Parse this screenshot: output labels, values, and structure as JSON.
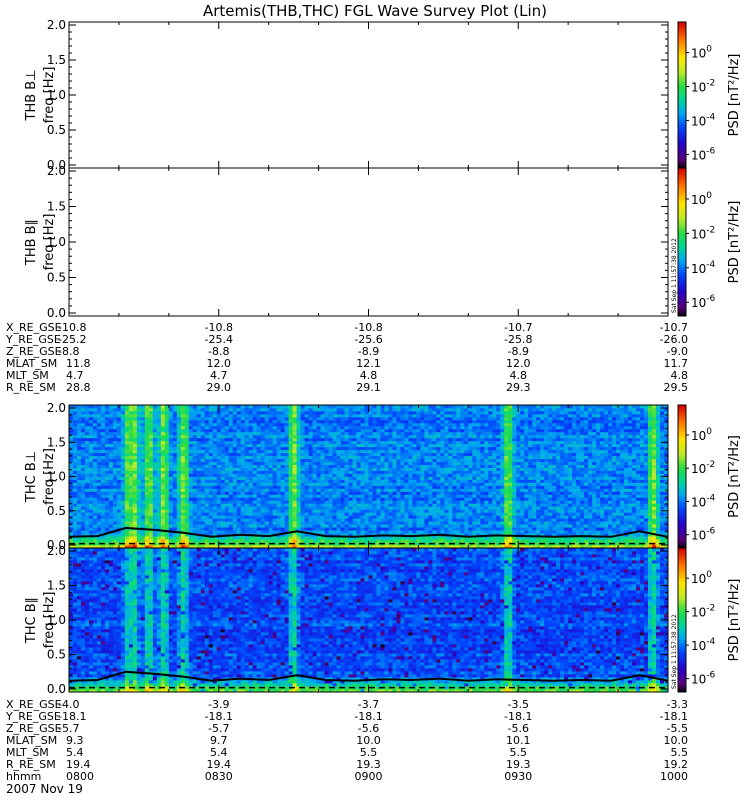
{
  "title": "Artemis(THB,THC) FGL Wave Survey Plot (Lin)",
  "stamp": "Sat Sep 1 11:57:38 2012",
  "date_label": "2007 Nov 19",
  "colorbar": {
    "label": "PSD [nT²/Hz]",
    "tick_labels": [
      "10^-6",
      "10^-4",
      "10^-2",
      "10^0"
    ],
    "log_range": [
      -6.8,
      1.8
    ]
  },
  "chart_data": [
    {
      "type": "heatmap",
      "panel": "THB B⊥",
      "ylabel_top": "THB B⊥",
      "ylabel_bottom": "freq [Hz]",
      "ylim": [
        0,
        2.0
      ],
      "yticks": [
        "0.0",
        "0.5",
        "1.0",
        "1.5",
        "2.0"
      ],
      "has_data": false
    },
    {
      "type": "heatmap",
      "panel": "THB B∥",
      "ylabel_top": "THB B∥",
      "ylabel_bottom": "freq [Hz]",
      "ylim": [
        0,
        2.0
      ],
      "yticks": [
        "0.0",
        "0.5",
        "1.0",
        "1.5",
        "2.0"
      ],
      "has_data": false
    },
    {
      "type": "heatmap",
      "panel": "THC B⊥",
      "ylabel_top": "THC B⊥",
      "ylabel_bottom": "freq [Hz]",
      "ylim": [
        0,
        2.0
      ],
      "yticks": [
        "0.0",
        "0.5",
        "1.0",
        "1.5",
        "2.0"
      ],
      "has_data": true,
      "bright_times": [
        "0812",
        "0813",
        "0816",
        "0819",
        "0823",
        "0845",
        "0928",
        "0957"
      ],
      "gyro_line_hz": [
        0.12,
        0.13,
        0.25,
        0.22,
        0.18,
        0.12,
        0.15,
        0.13,
        0.2,
        0.13,
        0.12,
        0.14,
        0.13,
        0.15,
        0.12,
        0.14,
        0.13,
        0.12,
        0.13,
        0.12,
        0.2,
        0.12
      ],
      "reference_line_hz": 0.02
    },
    {
      "type": "heatmap",
      "panel": "THC B∥",
      "ylabel_top": "THC B∥",
      "ylabel_bottom": "freq [Hz]",
      "ylim": [
        0,
        2.0
      ],
      "yticks": [
        "0.0",
        "0.5",
        "1.0",
        "1.5",
        "2.0"
      ],
      "has_data": true,
      "bright_times": [
        "0812",
        "0813",
        "0816",
        "0819",
        "0823",
        "0845",
        "0928",
        "0957"
      ],
      "gyro_line_hz": [
        0.12,
        0.13,
        0.25,
        0.22,
        0.18,
        0.12,
        0.15,
        0.13,
        0.2,
        0.13,
        0.12,
        0.14,
        0.13,
        0.15,
        0.12,
        0.14,
        0.13,
        0.12,
        0.13,
        0.12,
        0.2,
        0.12
      ],
      "reference_line_hz": 0.02
    }
  ],
  "ephem_thb": {
    "labels": [
      "X_RE_GSE",
      "Y_RE_GSE",
      "Z_RE_GSE",
      "MLAT_SM",
      "MLT_SM",
      "R_RE_SM"
    ],
    "rows": [
      [
        "-10.8",
        "-10.8",
        "-10.8",
        "-10.7",
        "-10.7"
      ],
      [
        "-25.2",
        "-25.4",
        "-25.6",
        "-25.8",
        "-26.0"
      ],
      [
        "-8.8",
        "-8.8",
        "-8.9",
        "-8.9",
        "-9.0"
      ],
      [
        "11.8",
        "12.0",
        "12.1",
        "12.0",
        "11.7"
      ],
      [
        "4.7",
        "4.7",
        "4.8",
        "4.8",
        "4.8"
      ],
      [
        "28.8",
        "29.0",
        "29.1",
        "29.3",
        "29.5"
      ]
    ]
  },
  "ephem_thc": {
    "labels": [
      "X_RE_GSE",
      "Y_RE_GSE",
      "Z_RE_GSE",
      "MLAT_SM",
      "MLT_SM",
      "R_RE_SM",
      "hhmm"
    ],
    "rows": [
      [
        "-4.0",
        "-3.9",
        "-3.7",
        "-3.5",
        "-3.3"
      ],
      [
        "-18.1",
        "-18.1",
        "-18.1",
        "-18.1",
        "-18.1"
      ],
      [
        "-5.7",
        "-5.7",
        "-5.6",
        "-5.6",
        "-5.5"
      ],
      [
        "9.3",
        "9.7",
        "10.0",
        "10.1",
        "10.0"
      ],
      [
        "5.4",
        "5.4",
        "5.5",
        "5.5",
        "5.5"
      ],
      [
        "19.4",
        "19.4",
        "19.3",
        "19.3",
        "19.2"
      ],
      [
        "0800",
        "0830",
        "0900",
        "0930",
        "1000"
      ]
    ]
  }
}
